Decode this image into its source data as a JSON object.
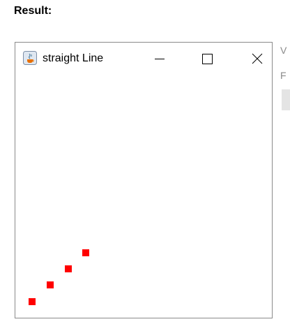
{
  "page": {
    "heading": "Result:"
  },
  "background": {
    "letters": [
      "V",
      "F"
    ]
  },
  "window": {
    "title": "straight Line",
    "icon": "java-icon",
    "controls": {
      "minimize_icon": "minimize-icon",
      "maximize_icon": "maximize-icon",
      "close_icon": "close-icon"
    }
  },
  "drawing": {
    "point_color": "#ff0000",
    "point_count": 4
  }
}
